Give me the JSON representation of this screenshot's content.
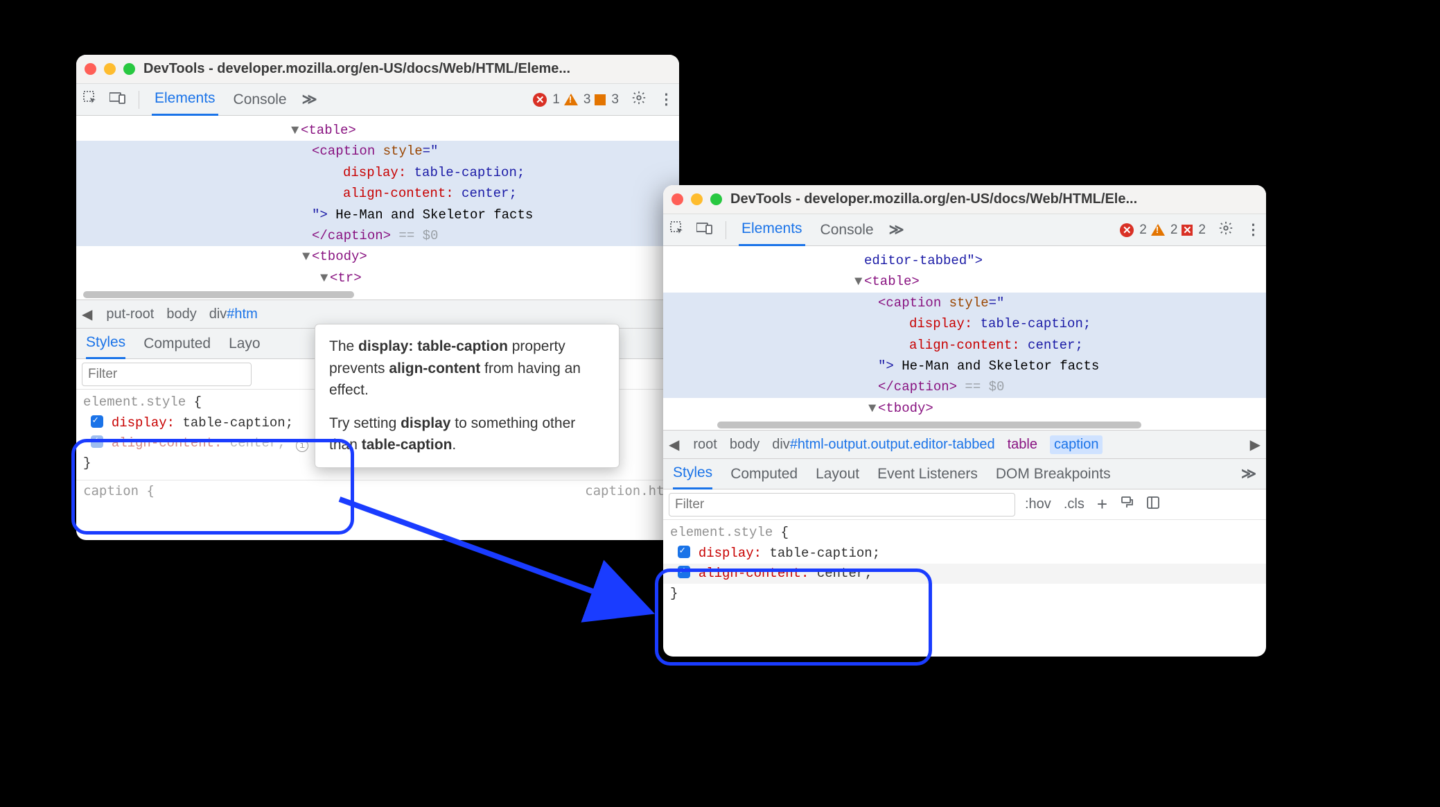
{
  "left": {
    "title": "DevTools - developer.mozilla.org/en-US/docs/Web/HTML/Eleme...",
    "tabs": {
      "elements": "Elements",
      "console": "Console"
    },
    "more": "≫",
    "issues": {
      "errors": "1",
      "warnings": "3",
      "flags": "3"
    },
    "dom": {
      "table_open": "<table>",
      "caption_open": "<caption",
      "style_attr": "style",
      "style_open": "=\"",
      "rule1_prop": "display",
      "rule1_val": "table-caption",
      "rule2_prop": "align-content",
      "rule2_val": "center",
      "style_close": "\"> ",
      "caption_text": "He-Man and Skeletor facts",
      "caption_close": "</caption>",
      "eq0": " == $0",
      "tbody_open": "<tbody>",
      "tr_open": "<tr>"
    },
    "breadcrumb": {
      "first": "put-root",
      "body": "body",
      "div": "div",
      "divrest": "#htm"
    },
    "subtabs": {
      "styles": "Styles",
      "computed": "Computed",
      "layout": "Layo"
    },
    "filter_placeholder": "Filter",
    "styles": {
      "selector": "element.style",
      "brace_open": " {",
      "brace_close": "}",
      "r1_prop": "display",
      "r1_val": "table-caption",
      "r2_prop": "align-content",
      "r2_val": "center"
    },
    "bottom_cut": "caption {",
    "bottom_right_cut": "caption.htm",
    "tooltip": {
      "p1a": "The ",
      "p1b": "display: table-caption",
      "p1c": " property prevents ",
      "p1d": "align-content",
      "p1e": " from having an effect.",
      "p2a": "Try setting ",
      "p2b": "display",
      "p2c": " to something other than ",
      "p2d": "table-caption",
      "p2e": "."
    }
  },
  "right": {
    "title": "DevTools - developer.mozilla.org/en-US/docs/Web/HTML/Ele...",
    "tabs": {
      "elements": "Elements",
      "console": "Console"
    },
    "more": "≫",
    "issues": {
      "errors": "2",
      "warnings": "2",
      "flags": "2"
    },
    "dom": {
      "editor_tabbed": "editor-tabbed\">",
      "table_open": "<table>",
      "caption_open": "<caption",
      "style_attr": "style",
      "style_open": "=\"",
      "rule1_prop": "display",
      "rule1_val": "table-caption",
      "rule2_prop": "align-content",
      "rule2_val": "center",
      "style_close": "\"> ",
      "caption_text": "He-Man and Skeletor facts",
      "caption_close": "</caption>",
      "eq0": " == $0",
      "tbody_open": "<tbody>"
    },
    "breadcrumb": {
      "root": "root",
      "body": "body",
      "div_full": "div#html-output.output.editor-tabbed",
      "table": "table",
      "caption": "caption"
    },
    "subtabs": {
      "styles": "Styles",
      "computed": "Computed",
      "layout": "Layout",
      "events": "Event Listeners",
      "dom": "DOM Breakpoints"
    },
    "filter_placeholder": "Filter",
    "hov": ":hov",
    "cls": ".cls",
    "styles": {
      "selector": "element.style",
      "brace_open": " {",
      "brace_close": "}",
      "r1_prop": "display",
      "r1_val": "table-caption",
      "r2_prop": "align-content",
      "r2_val": "center"
    }
  }
}
